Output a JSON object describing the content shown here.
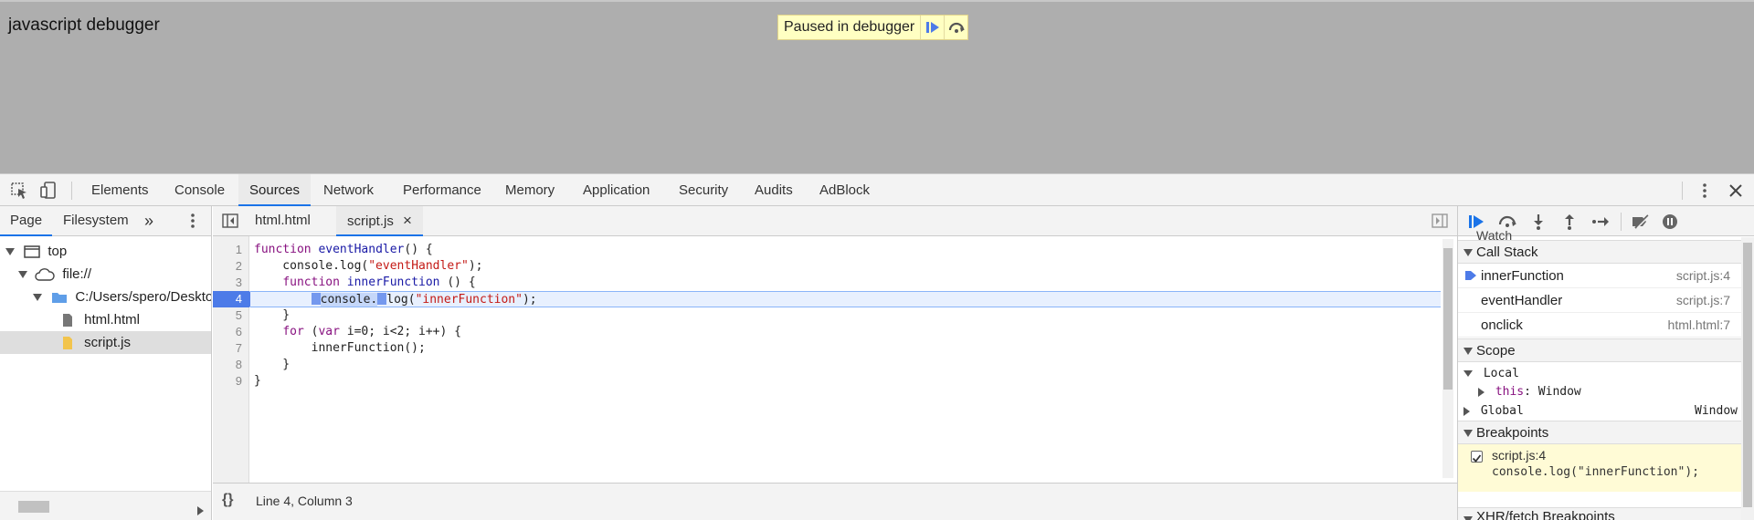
{
  "page": {
    "heading": "javascript debugger",
    "paused_label": "Paused in debugger"
  },
  "devtools": {
    "main_tabs": [
      "Elements",
      "Console",
      "Sources",
      "Network",
      "Performance",
      "Memory",
      "Application",
      "Security",
      "Audits",
      "AdBlock"
    ],
    "active_main_tab": "Sources",
    "navigator": {
      "tabs": [
        "Page",
        "Filesystem"
      ],
      "more": "»",
      "tree": [
        {
          "label": "top"
        },
        {
          "label": "file://"
        },
        {
          "label": "C:/Users/spero/Desktop"
        },
        {
          "label": "html.html"
        },
        {
          "label": "script.js"
        }
      ]
    },
    "editor": {
      "tabs": [
        "html.html",
        "script.js"
      ],
      "close_glyph": "×",
      "line_numbers": [
        "1",
        "2",
        "3",
        "4",
        "5",
        "6",
        "7",
        "8",
        "9"
      ],
      "code": {
        "l1_kw": "function",
        "l1_fn": "eventHandler",
        "l1_rest": "() {",
        "l2_pre": "    console.log(",
        "l2_str": "\"eventHandler\"",
        "l2_post": ");",
        "l3_indent": "    ",
        "l3_kw": "function",
        "l3_fn": "innerFunction",
        "l3_rest": " () {",
        "l4_indent": "        ",
        "l4_a": "console.",
        "l4_b": "log(",
        "l4_str": "\"innerFunction\"",
        "l4_post": ");",
        "l5": "    }",
        "l6_indent": "    ",
        "l6_kw": "for",
        "l6_open": " (",
        "l6_kw2": "var",
        "l6_rest": " i=0; i<2; i++) {",
        "l7": "        innerFunction();",
        "l8": "    }",
        "l9": "}"
      },
      "status": "Line 4, Column 3",
      "format_glyph": "{}"
    },
    "sidebar": {
      "watch_label": "Watch",
      "call_stack_label": "Call Stack",
      "frames": [
        {
          "name": "innerFunction",
          "loc": "script.js:4"
        },
        {
          "name": "eventHandler",
          "loc": "script.js:7"
        },
        {
          "name": "onclick",
          "loc": "html.html:7"
        }
      ],
      "scope_label": "Scope",
      "local_label": "Local",
      "this_key": "this",
      "this_val": ": Window",
      "global_label": "Global",
      "global_val": "Window",
      "breakpoints_label": "Breakpoints",
      "breakpoint": {
        "file": "script.js:4",
        "code": "console.log(\"innerFunction\");"
      },
      "xhr_label": "XHR/fetch Breakpoints"
    }
  },
  "colors": {
    "accent": "#1a73e8",
    "breakpoint": "#4d7be8",
    "paused_bg": "#ffffc2"
  }
}
